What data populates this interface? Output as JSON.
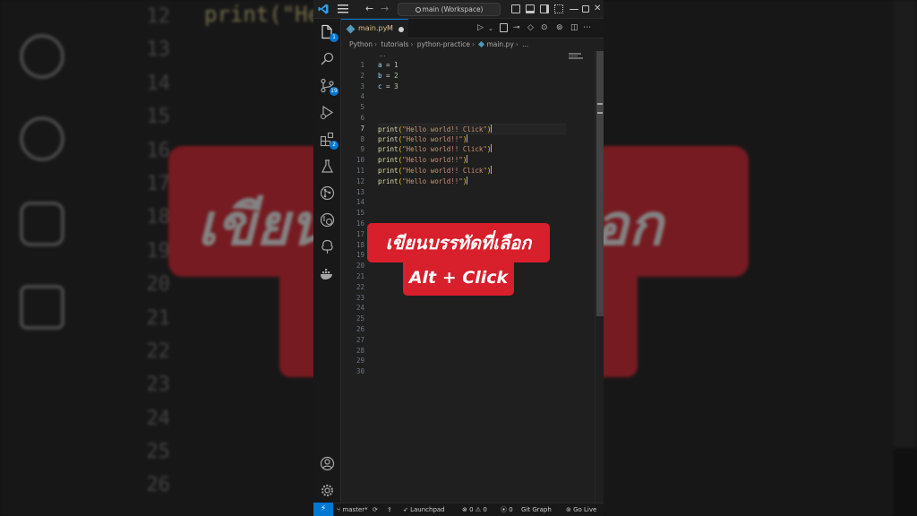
{
  "background": {
    "line_numbers": [
      "12",
      "13",
      "14",
      "15",
      "16",
      "17",
      "18",
      "19",
      "20",
      "21",
      "22",
      "23",
      "24",
      "25",
      "26"
    ],
    "code_fragment": "print(\"He",
    "banner_text": "เขียนบรรทัดที่เลือก"
  },
  "titlebar": {
    "back_icon": "←",
    "forward_icon": "→",
    "command_center": "main (Workspace)",
    "close_icon": "✕"
  },
  "activity_bar": {
    "items": [
      {
        "name": "explorer",
        "badge": "1"
      },
      {
        "name": "search",
        "badge": ""
      },
      {
        "name": "source-control",
        "badge": "19"
      },
      {
        "name": "run-debug",
        "badge": ""
      },
      {
        "name": "extensions",
        "badge": "2"
      },
      {
        "name": "testing",
        "badge": ""
      },
      {
        "name": "git-graph",
        "badge": ""
      },
      {
        "name": "remote-explorer",
        "badge": ""
      },
      {
        "name": "gitlens",
        "badge": ""
      },
      {
        "name": "docker",
        "badge": ""
      }
    ]
  },
  "tab": {
    "filename": "main.py",
    "status": "M"
  },
  "breadcrumbs": [
    "Python",
    "tutorials",
    "python-practice",
    "main.py",
    "..."
  ],
  "editor": {
    "ellipsis": "...",
    "active_line": 7,
    "line_numbers": [
      "1",
      "2",
      "3",
      "4",
      "5",
      "6",
      "7",
      "8",
      "9",
      "10",
      "11",
      "12",
      "13",
      "14",
      "15",
      "16",
      "17",
      "18",
      "19",
      "20",
      "21",
      "22",
      "23",
      "24",
      "25",
      "26",
      "27",
      "28",
      "29",
      "30"
    ],
    "lines": [
      "a = 1",
      "b = 2",
      "c = 3",
      "",
      "",
      "",
      "print(\"Hello world!! Click\")",
      "print(\"Hello world!!\")",
      "print(\"Hello world!! Click\")",
      "print(\"Hello world!!\")",
      "print(\"Hello world!! Click\")",
      "print(\"Hello world!!\")"
    ]
  },
  "statusbar": {
    "remote_icon": "⚡",
    "branch": "master*",
    "sync_icon": "⟳",
    "publish_icon": "⇪",
    "launchpad": "Launchpad",
    "errors": "0",
    "warnings": "0",
    "ports": "0",
    "git_graph": "Git Graph",
    "go_live": "Go Live"
  },
  "caption": {
    "line1": "เขียนบรรทัดที่เลือก",
    "line2": "Alt + Click"
  },
  "colors": {
    "accent": "#0078d4",
    "caption_red": "#d81f2c",
    "editor_bg": "#1f1f1f"
  }
}
